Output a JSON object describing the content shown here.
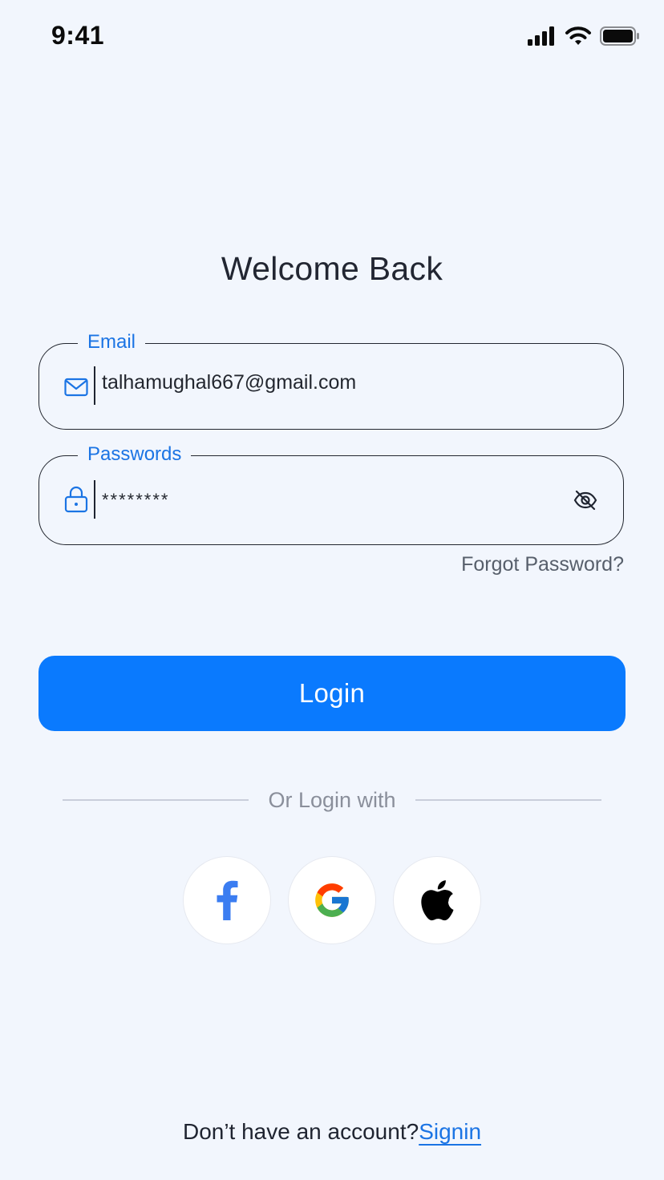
{
  "status_bar": {
    "time": "9:41"
  },
  "title": "Welcome Back",
  "email": {
    "label": "Email",
    "value": "talhamughal667@gmail.com"
  },
  "password": {
    "label": "Passwords",
    "value": "********"
  },
  "forgot_password": "Forgot Password?",
  "login_button": "Login",
  "divider_text": "Or Login with",
  "social": {
    "icons": [
      "facebook-icon",
      "google-icon",
      "apple-icon"
    ]
  },
  "signup": {
    "prompt": "Don’t have an account?",
    "link": "Signin"
  },
  "colors": {
    "background": "#f2f6fd",
    "accent": "#0a7afe",
    "label_blue": "#1b74e4",
    "text": "#1f2430",
    "muted": "#8a8f9b"
  }
}
